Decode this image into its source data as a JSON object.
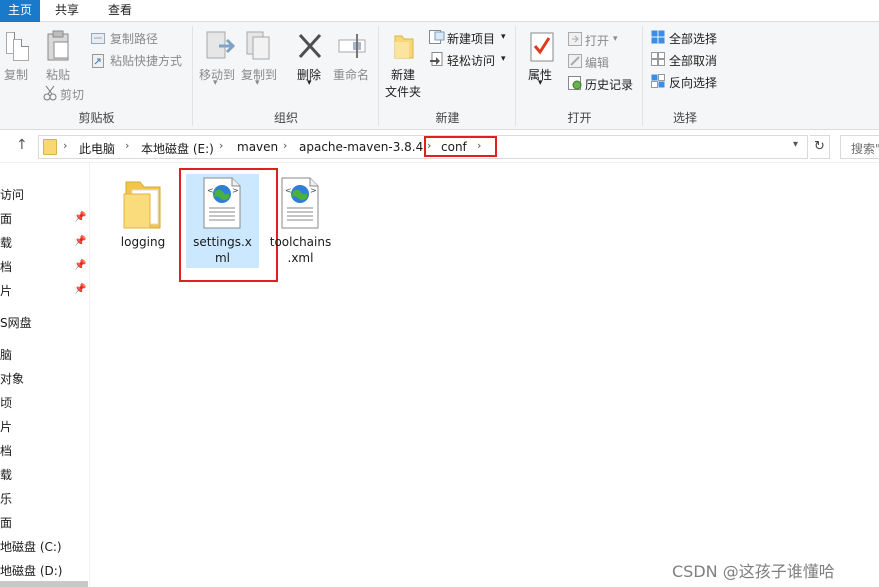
{
  "tabs": {
    "file": "主页",
    "share": "共享",
    "view": "查看"
  },
  "ribbon": {
    "clipboard": {
      "title": "剪贴板",
      "copy": "复制",
      "paste": "粘贴",
      "copy_path": "复制路径",
      "paste_shortcut": "粘贴快捷方式",
      "cut": "剪切"
    },
    "organize": {
      "title": "组织",
      "move_to": "移动到",
      "copy_to": "复制到",
      "delete": "删除",
      "rename": "重命名"
    },
    "new": {
      "title": "新建",
      "new_folder_line1": "新建",
      "new_folder_line2": "文件夹",
      "new_item": "新建项目",
      "easy_access": "轻松访问"
    },
    "open": {
      "title": "打开",
      "properties": "属性",
      "open": "打开",
      "edit": "编辑",
      "history": "历史记录"
    },
    "select": {
      "title": "选择",
      "select_all": "全部选择",
      "select_none": "全部取消",
      "invert": "反向选择"
    }
  },
  "address": {
    "crumbs": [
      "此电脑",
      "本地磁盘 (E:)",
      "maven",
      "apache-maven-3.8.4",
      "conf"
    ],
    "search_placeholder": "搜索\""
  },
  "nav": {
    "items": [
      {
        "label": "访问",
        "pinned": false
      },
      {
        "label": "面",
        "pinned": true
      },
      {
        "label": "载",
        "pinned": true
      },
      {
        "label": "档",
        "pinned": true
      },
      {
        "label": "片",
        "pinned": true
      },
      {
        "label": "S网盘",
        "pinned": false
      },
      {
        "label": "脑",
        "pinned": false
      },
      {
        "label": "对象",
        "pinned": false
      },
      {
        "label": "顷",
        "pinned": false
      },
      {
        "label": "片",
        "pinned": false
      },
      {
        "label": "档",
        "pinned": false
      },
      {
        "label": "载",
        "pinned": false
      },
      {
        "label": "乐",
        "pinned": false
      },
      {
        "label": "面",
        "pinned": false
      },
      {
        "label": "地磁盘 (C:)",
        "pinned": false
      },
      {
        "label": "地磁盘 (D:)",
        "pinned": false
      }
    ]
  },
  "files": [
    {
      "name": "logging",
      "type": "folder"
    },
    {
      "name": "settings.xml",
      "type": "xml",
      "selected": true,
      "line1": "settings.x",
      "line2": "ml"
    },
    {
      "name": "toolchains.xml",
      "type": "xml",
      "line1": "toolchains",
      "line2": ".xml"
    }
  ],
  "watermark": "CSDN @这孩子谁懂哈",
  "colors": {
    "accent": "#1979ca",
    "selection": "#cce8ff",
    "highlight_box": "#e02020",
    "folder": "#f8d775"
  }
}
